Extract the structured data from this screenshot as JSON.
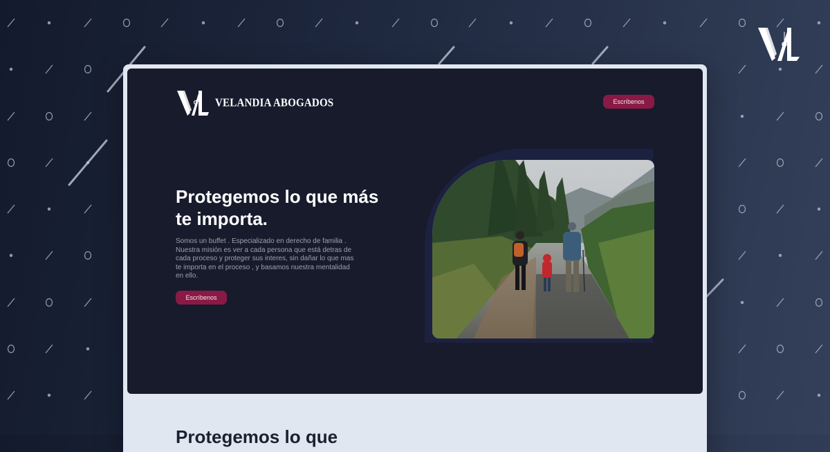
{
  "brand": {
    "name": "VELANDIA ABOGADOS"
  },
  "header": {
    "cta_label": "Escríbenos"
  },
  "hero": {
    "headline": "Protegemos lo que más te importa.",
    "description": "Somos un buffet . Especializado en derecho de familia . Nuestra misión es ver a cada persona que está detras de cada proceso y proteger sus interes, sin dañar lo que mas te importa en el proceso , y basamos nuestra mentalidad en ello.",
    "cta_label": "Escríbenos"
  },
  "section_below": {
    "title": "Protegemos lo que"
  },
  "colors": {
    "accent": "#8a1a45",
    "hero_bg": "#181b2c",
    "page_bg": "#e1e7f0"
  },
  "icons": {
    "logo": "velandia-monogram"
  }
}
